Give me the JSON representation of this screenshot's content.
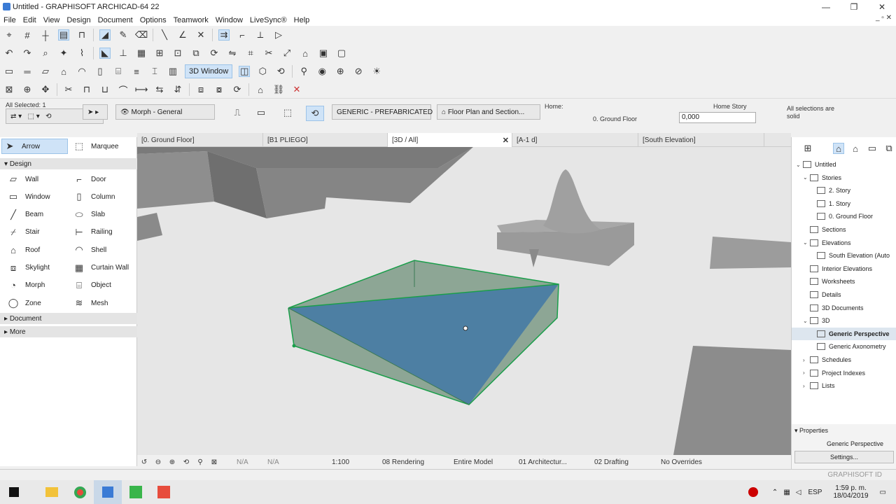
{
  "window": {
    "title": "Untitled - GRAPHISOFT ARCHICAD-64 22",
    "controls": [
      "—",
      "❐",
      "✕"
    ]
  },
  "menu": [
    "File",
    "Edit",
    "View",
    "Design",
    "Document",
    "Options",
    "Teamwork",
    "Window",
    "LiveSync®",
    "Help"
  ],
  "toolbar": {
    "three_d_window": "3D Window"
  },
  "infobox": {
    "selection": "All Selected: 1",
    "morph_button": "Morph - General",
    "material_button": "GENERIC - PREFABRICATED",
    "floorplan_button": "Floor Plan and Section...",
    "home_label": "Home:",
    "home_value": "0. Ground Floor",
    "home_story_label": "Home Story",
    "offset_value": "0,000",
    "selection_note_1": "All selections are",
    "selection_note_2": "solid"
  },
  "tabs": [
    {
      "label": "[0. Ground Floor]"
    },
    {
      "label": "[B1 PLIEGO]"
    },
    {
      "label": "[3D / All]",
      "close": "✕"
    },
    {
      "label": "[A-1 d]"
    },
    {
      "label": "[South Elevation]"
    }
  ],
  "toolbox": {
    "arrow": "Arrow",
    "marquee": "Marquee",
    "design_section": "Design",
    "tools": [
      {
        "label": "Wall",
        "icon": "wall-icon"
      },
      {
        "label": "Door",
        "icon": "door-icon"
      },
      {
        "label": "Window",
        "icon": "window-icon"
      },
      {
        "label": "Column",
        "icon": "column-icon"
      },
      {
        "label": "Beam",
        "icon": "beam-icon"
      },
      {
        "label": "Slab",
        "icon": "slab-icon"
      },
      {
        "label": "Stair",
        "icon": "stair-icon"
      },
      {
        "label": "Railing",
        "icon": "railing-icon"
      },
      {
        "label": "Roof",
        "icon": "roof-icon"
      },
      {
        "label": "Shell",
        "icon": "shell-icon"
      },
      {
        "label": "Skylight",
        "icon": "skylight-icon"
      },
      {
        "label": "Curtain Wall",
        "icon": "curtain-wall-icon"
      },
      {
        "label": "Morph",
        "icon": "morph-icon"
      },
      {
        "label": "Object",
        "icon": "object-icon"
      },
      {
        "label": "Zone",
        "icon": "zone-icon"
      },
      {
        "label": "Mesh",
        "icon": "mesh-icon"
      }
    ],
    "document_section": "Document",
    "more_section": "More"
  },
  "statusbar": {
    "na1": "N/A",
    "na2": "N/A",
    "scale": "1:100",
    "rendering": "08 Rendering",
    "model": "Entire Model",
    "architecture": "01 Architectur...",
    "drafting": "02 Drafting",
    "overrides": "No Overrides"
  },
  "navigator": {
    "items": [
      {
        "label": "Untitled",
        "level": 0,
        "arrow": "⌄"
      },
      {
        "label": "Stories",
        "level": 1,
        "arrow": "⌄"
      },
      {
        "label": "2. Story",
        "level": 2,
        "arrow": ""
      },
      {
        "label": "1. Story",
        "level": 2,
        "arrow": ""
      },
      {
        "label": "0. Ground Floor",
        "level": 2,
        "arrow": ""
      },
      {
        "label": "Sections",
        "level": 1,
        "arrow": ""
      },
      {
        "label": "Elevations",
        "level": 1,
        "arrow": "⌄"
      },
      {
        "label": "South Elevation (Auto",
        "level": 2,
        "arrow": ""
      },
      {
        "label": "Interior Elevations",
        "level": 1,
        "arrow": ""
      },
      {
        "label": "Worksheets",
        "level": 1,
        "arrow": ""
      },
      {
        "label": "Details",
        "level": 1,
        "arrow": ""
      },
      {
        "label": "3D Documents",
        "level": 1,
        "arrow": ""
      },
      {
        "label": "3D",
        "level": 1,
        "arrow": "⌄"
      },
      {
        "label": "Generic Perspective",
        "level": 2,
        "arrow": "",
        "selected": true
      },
      {
        "label": "Generic Axonometry",
        "level": 2,
        "arrow": ""
      },
      {
        "label": "Schedules",
        "level": 1,
        "arrow": "›"
      },
      {
        "label": "Project Indexes",
        "level": 1,
        "arrow": "›"
      },
      {
        "label": "Lists",
        "level": 1,
        "arrow": "›"
      }
    ]
  },
  "properties": {
    "title": "Properties",
    "value": "Generic Perspective",
    "settings": "Settings..."
  },
  "graphisoft_id": "GRAPHISOFT ID",
  "taskbar": {
    "lang": "ESP",
    "time": "1:59 p. m.",
    "date": "18/04/2019"
  },
  "colors": {
    "selected_face": "#4d7fa3",
    "selection_edge": "#1a9e4a",
    "gray_mass": "#8c8c8c"
  }
}
